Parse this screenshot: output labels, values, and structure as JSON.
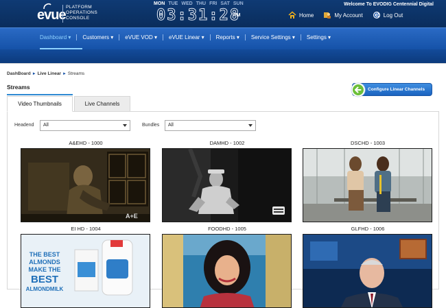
{
  "brand": {
    "logo_text": "evue",
    "subtitle_line1": "PLATFORM",
    "subtitle_line2": "OPERATIONS",
    "subtitle_line3": "CONSOLE"
  },
  "clock": {
    "days": [
      "MON",
      "TUE",
      "WED",
      "THU",
      "FRI",
      "SAT",
      "SUN"
    ],
    "active_day": "MON",
    "time": "03:31:28",
    "ampm": "PM"
  },
  "header": {
    "welcome": "Welcome To EVODIG Centennial Digital",
    "links": [
      {
        "label": "Home",
        "icon": "home-icon"
      },
      {
        "label": "My Account",
        "icon": "account-icon"
      },
      {
        "label": "Log Out",
        "icon": "logout-icon"
      }
    ]
  },
  "nav": {
    "items": [
      {
        "label": "Dashboard ▾",
        "active": true
      },
      {
        "label": "Customers ▾"
      },
      {
        "label": "eVUE VOD ▾"
      },
      {
        "label": "eVUE Linear ▾"
      },
      {
        "label": "Reports ▾"
      },
      {
        "label": "Service Settings ▾"
      },
      {
        "label": "Settings ▾"
      }
    ]
  },
  "breadcrumb": {
    "items": [
      "DashBoard",
      "Live Linear",
      "Streams"
    ]
  },
  "page": {
    "title": "Streams",
    "config_button": "Configure Linear Channels"
  },
  "tabs": [
    {
      "label": "Video Thumbnails",
      "active": true
    },
    {
      "label": "Live Channels",
      "active": false
    }
  ],
  "filters": {
    "headend_label": "Headend",
    "headend_value": "All",
    "bundles_label": "Bundles",
    "bundles_value": "All"
  },
  "thumbnails": [
    {
      "label": "A&EHD - 1000",
      "watermark": "A+E"
    },
    {
      "label": "DAMHD - 1002"
    },
    {
      "label": "DSCHD - 1003"
    },
    {
      "label": "EI HD - 1004",
      "overlay_text": [
        "THE BEST",
        "ALMONDS",
        "MAKE THE",
        "BEST",
        "ALMONDMILK"
      ]
    },
    {
      "label": "FOODHD - 1005"
    },
    {
      "label": "GLFHD - 1006"
    }
  ],
  "colors": {
    "header_dark": "#0a2d5c",
    "nav_blue": "#1552a8",
    "active_nav": "#8fd2ff",
    "button_blue": "#1b63c0",
    "accent_green": "#6cbf3a"
  }
}
